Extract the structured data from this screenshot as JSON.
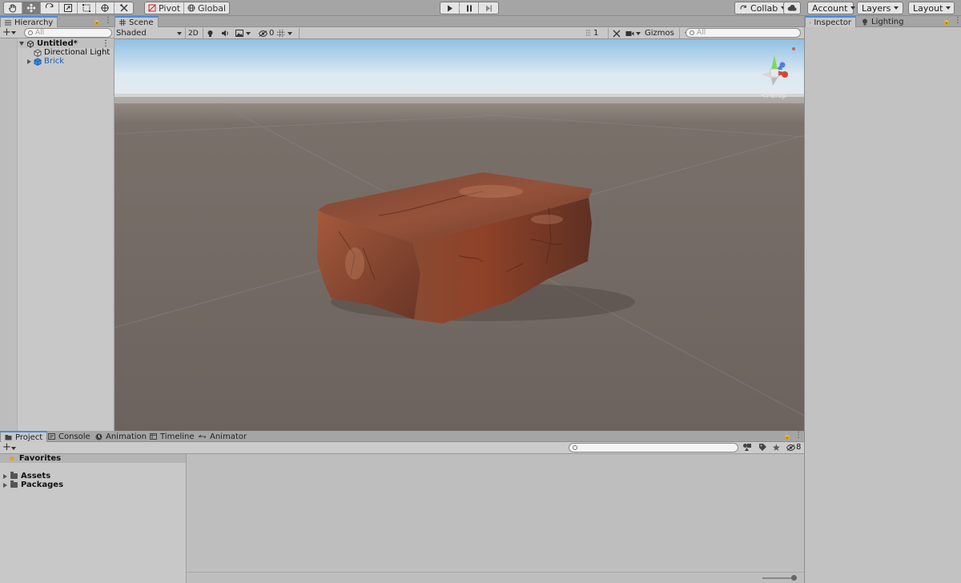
{
  "toolbar": {
    "pivot_label": "Pivot",
    "global_label": "Global",
    "collab_label": "Collab",
    "account_label": "Account",
    "layers_label": "Layers",
    "layout_label": "Layout"
  },
  "hierarchy": {
    "tab_label": "Hierarchy",
    "search_placeholder": "All",
    "scene_name": "Untitled*",
    "items": [
      {
        "label": "Directional Light"
      },
      {
        "label": "Brick"
      }
    ]
  },
  "scene": {
    "tab_label": "Scene",
    "shading_mode": "Shaded",
    "mode_2d_label": "2D",
    "hidden_count": "0",
    "camera_count": "1",
    "gizmos_label": "Gizmos",
    "search_placeholder": "All",
    "view_label": "<Persp"
  },
  "inspector": {
    "tabs": [
      {
        "label": "Inspector"
      },
      {
        "label": "Lighting"
      }
    ]
  },
  "project": {
    "tabs": [
      {
        "label": "Project"
      },
      {
        "label": "Console"
      },
      {
        "label": "Animation"
      },
      {
        "label": "Timeline"
      },
      {
        "label": "Animator"
      }
    ],
    "favorites_label": "Favorites",
    "folders": [
      {
        "label": "Assets"
      },
      {
        "label": "Packages"
      }
    ],
    "hidden_count": "8"
  },
  "colors": {
    "active_tab_accent": "#4a8de0",
    "brick": "#8a3f25",
    "ground": "#6f6560",
    "link_blue": "#1a5fb4"
  }
}
